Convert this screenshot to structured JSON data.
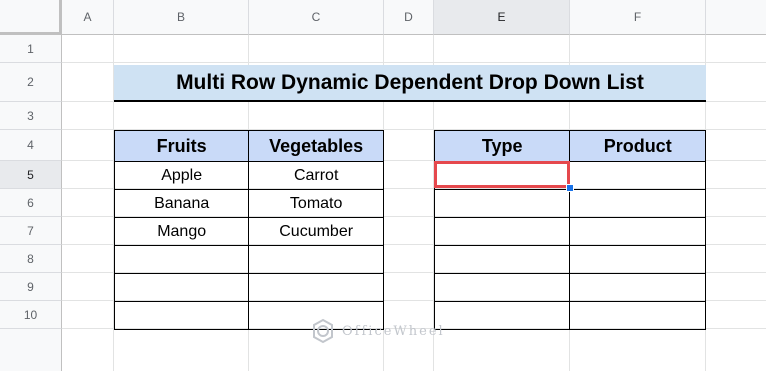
{
  "columns": [
    "A",
    "B",
    "C",
    "D",
    "E",
    "F"
  ],
  "rows": [
    "1",
    "2",
    "3",
    "4",
    "5",
    "6",
    "7",
    "8",
    "9",
    "10"
  ],
  "selected_column": "E",
  "selected_row": "5",
  "title": "Multi Row Dynamic Dependent Drop Down List",
  "source_table": {
    "headers": [
      "Fruits",
      "Vegetables"
    ],
    "rows": [
      [
        "Apple",
        "Carrot"
      ],
      [
        "Banana",
        "Tomato"
      ],
      [
        "Mango",
        "Cucumber"
      ],
      [
        "",
        ""
      ],
      [
        "",
        ""
      ],
      [
        "",
        ""
      ]
    ]
  },
  "target_table": {
    "headers": [
      "Type",
      "Product"
    ],
    "rows": [
      [
        "",
        ""
      ],
      [
        "",
        ""
      ],
      [
        "",
        ""
      ],
      [
        "",
        ""
      ],
      [
        "",
        ""
      ],
      [
        "",
        ""
      ]
    ]
  },
  "colors": {
    "title_fill": "#cfe2f3",
    "header_fill": "#c9daf8",
    "selection_border": "#e5484d",
    "fill_handle": "#1a73e8"
  },
  "watermark": {
    "text": "OfficeWheel",
    "icon": "officewheel-logo-icon"
  }
}
